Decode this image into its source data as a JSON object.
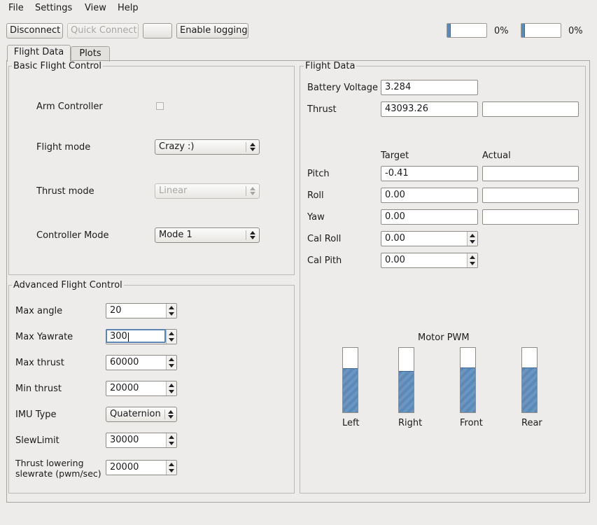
{
  "menu": [
    "File",
    "Settings",
    "View",
    "Help"
  ],
  "toolbar": {
    "disconnect": "Disconnect",
    "quick_connect": "Quick Connect",
    "blank": "",
    "enable_logging": "Enable logging",
    "progress1": {
      "value": 0,
      "label": "0%"
    },
    "progress2": {
      "value": 0,
      "label": "0%"
    }
  },
  "tabs": {
    "flight_data": "Flight Data",
    "plots": "Plots"
  },
  "basic": {
    "title": "Basic Flight Control",
    "arm_label": "Arm Controller",
    "arm_checked": false,
    "flight_mode_label": "Flight mode",
    "flight_mode_value": "Crazy :)",
    "thrust_mode_label": "Thrust mode",
    "thrust_mode_value": "Linear",
    "controller_mode_label": "Controller Mode",
    "controller_mode_value": "Mode 1"
  },
  "advanced": {
    "title": "Advanced Flight Control",
    "fields": [
      {
        "label": "Max angle",
        "value": "20"
      },
      {
        "label": "Max Yawrate",
        "value": "300"
      },
      {
        "label": "Max thrust",
        "value": "60000"
      },
      {
        "label": "Min thrust",
        "value": "20000"
      },
      {
        "label": "IMU Type",
        "value": "Quaternion"
      },
      {
        "label": "SlewLimit",
        "value": "30000"
      },
      {
        "label_line1": "Thrust lowering",
        "label_line2": "slewrate (pwm/sec)",
        "value": "20000"
      }
    ]
  },
  "flight": {
    "title": "Flight Data",
    "battery_label": "Battery Voltage",
    "battery_value": "3.284",
    "thrust_label": "Thrust",
    "thrust_value": "43093.26",
    "thrust_actual": "",
    "target_header": "Target",
    "actual_header": "Actual",
    "pitch_label": "Pitch",
    "pitch_target": "-0.41",
    "pitch_actual": "",
    "roll_label": "Roll",
    "roll_target": "0.00",
    "roll_actual": "",
    "yaw_label": "Yaw",
    "yaw_target": "0.00",
    "yaw_actual": "",
    "cal_roll_label": "Cal Roll",
    "cal_roll_value": "0.00",
    "cal_pitch_label": "Cal Pith",
    "cal_pitch_value": "0.00"
  },
  "motor_pwm": {
    "title": "Motor PWM",
    "motors": [
      {
        "label": "Left",
        "level": 0.67
      },
      {
        "label": "Right",
        "level": 0.63
      },
      {
        "label": "Front",
        "level": 0.68
      },
      {
        "label": "Rear",
        "level": 0.68
      }
    ]
  }
}
